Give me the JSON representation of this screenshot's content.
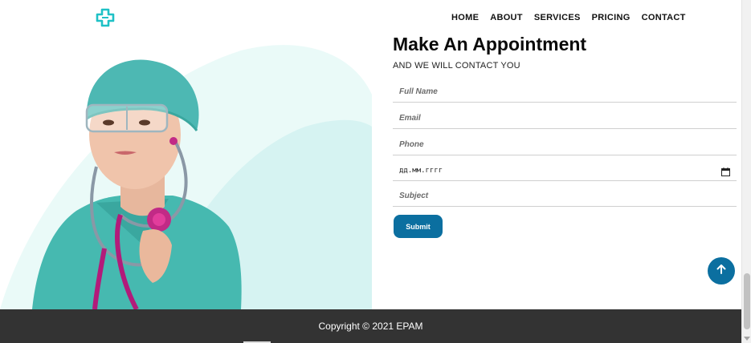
{
  "nav": {
    "items": [
      "HOME",
      "ABOUT",
      "SERVICES",
      "PRICING",
      "CONTACT"
    ]
  },
  "appointment": {
    "title": "Make An Appointment",
    "subtitle": "AND WE WILL CONTACT YOU",
    "fields": {
      "full_name_placeholder": "Full Name",
      "email_placeholder": "Email",
      "phone_placeholder": "Phone",
      "date_value": "дд.мм.гггг",
      "subject_placeholder": "Subject"
    },
    "submit_label": "Submit"
  },
  "footer": {
    "copyright": "Copyright © 2021 EPAM"
  },
  "colors": {
    "accent": "#0b6fa0",
    "logo": "#1fc1c6",
    "footer_bg": "#333333",
    "scrub_teal": "#3fb8b0"
  },
  "icons": {
    "logo": "medical-cross-icon",
    "scroll_top": "arrow-up-icon",
    "calendar": "calendar-icon"
  }
}
